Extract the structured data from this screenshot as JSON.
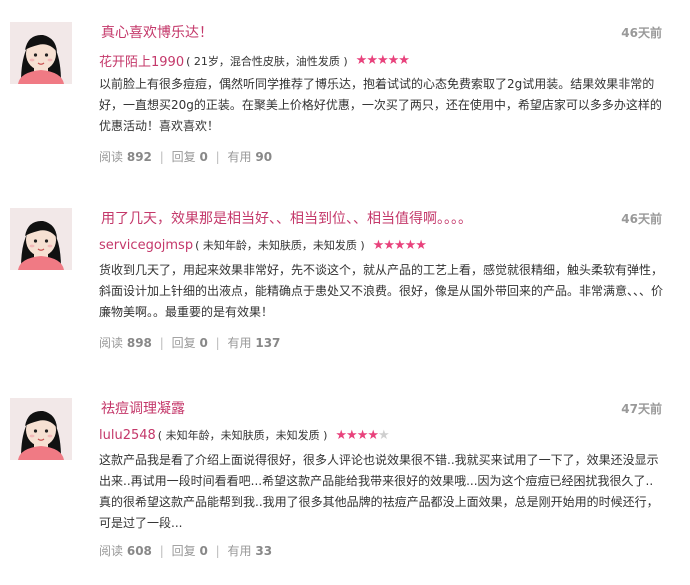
{
  "reviews": [
    {
      "title": "真心喜欢博乐达！",
      "time": "46天前",
      "username": "花开陌上1990",
      "profile": "( 21岁，混合性皮肤，油性发质 )",
      "rating": 5,
      "body": "以前脸上有很多痘痘，偶然听同学推荐了博乐达，抱着试试的心态免费索取了2g试用装。结果效果非常的好，一直想买20g的正装。在聚美上价格好优惠，一次买了两只，还在使用中，希望店家可以多多办这样的优惠活动！喜欢喜欢！",
      "read_label": "阅读",
      "read": "892",
      "reply_label": "回复",
      "reply": "0",
      "useful_label": "有用",
      "useful": "90"
    },
    {
      "title": "用了几天，效果那是相当好、、相当到位、、相当值得啊。。。。",
      "time": "46天前",
      "username": "servicegojmsp",
      "profile": "( 未知年龄，未知肤质，未知发质 )",
      "rating": 5,
      "body": "货收到几天了，用起来效果非常好，先不谈这个，就从产品的工艺上看，感觉就很精细，触头柔软有弹性，斜面设计加上针细的出液点，能精确点于患处又不浪费。很好，像是从国外带回来的产品。非常满意、、、价廉物美啊。。最重要的是有效果！",
      "read_label": "阅读",
      "read": "898",
      "reply_label": "回复",
      "reply": "0",
      "useful_label": "有用",
      "useful": "137"
    },
    {
      "title": "祛痘调理凝露",
      "time": "47天前",
      "username": "lulu2548",
      "profile": "( 未知年龄，未知肤质，未知发质 )",
      "rating": 4,
      "body": "这款产品我是看了介绍上面说得很好，很多人评论也说效果很不错..我就买来试用了一下了，效果还没显示出来..再试用一段时间看看吧...希望这款产品能给我带来很好的效果哦...因为这个痘痘已经困扰我很久了..真的很希望这款产品能帮到我..我用了很多其他品牌的祛痘产品都没上面效果，总是刚开始用的时候还行，可是过了一段...",
      "read_label": "阅读",
      "read": "608",
      "reply_label": "回复",
      "reply": "0",
      "useful_label": "有用",
      "useful": "33"
    }
  ]
}
